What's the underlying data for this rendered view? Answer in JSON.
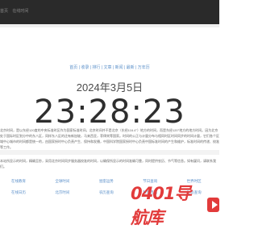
{
  "header": {
    "breadcrumb": [
      "首页",
      "在线时间"
    ]
  },
  "nav": {
    "text": "首页 | 收录 | 排行 | 文章 | 新闻 | 最新 | 万年历"
  },
  "clock": {
    "date": "2024年3月5日",
    "time": "23:28:23"
  },
  "content": {
    "paragraph1": "北京时间，是以东经120度的中央标准时区作为国家标准时间，北京时间并不是北京（东经116.4°）地方的时间，而是东经120°地方的地方时间。因为北京处于国际时区划分中的东八区，同样东八区的还有新加坡，马来西亚，菲律宾等国家。时间的公正与计量分布与相同时区时间同步的时间计量，它们各个区域中心城市的时间都是统一的，由国家授时中心负责产生、保持和发播，中国科学院国家授时中心负责中国标准时间的产生和维护，标准时间的传递、校准等工作。",
    "paragraph2": "本站所显示的时间，精确至秒，采用北京时间同步服务器校准的时间，以确保所显示的时间准确可靠，同时提供农历、节气等信息。如有疑问，请联系我们。"
  },
  "links": {
    "row1": [
      "在线教育",
      "全球时间",
      "星座运势",
      "节日查询",
      "世界时区"
    ],
    "row2": [
      "在线日历",
      "北京时间",
      "农历查询",
      "科普百科",
      "生肖查询"
    ]
  },
  "watermark": {
    "text": "0401导航库"
  },
  "colors": {
    "topbar": "#2a2a2a",
    "link": "#5a8fc9",
    "watermark": "#e23b3b"
  }
}
